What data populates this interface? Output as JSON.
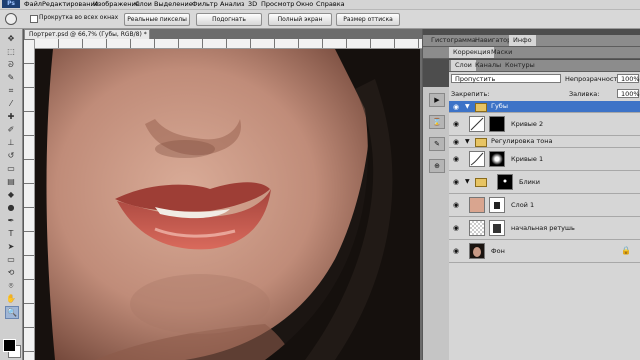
{
  "app": {
    "logo": "Ps"
  },
  "menu": [
    "Файл",
    "Редактирование",
    "Изображение",
    "Слои",
    "Выделение",
    "Фильтр",
    "Анализ",
    "3D",
    "Просмотр",
    "Окно",
    "Справка"
  ],
  "options_bar": {
    "scroll_all_label": "Прокрутка во всех окнах",
    "buttons": [
      "Реальные пикселы",
      "Подогнать",
      "Полный экран",
      "Размер оттиска"
    ]
  },
  "document": {
    "tab_title": "Портрет.psd @ 66,7% (Губы, RGB/8) *"
  },
  "panels": {
    "top_tabs": [
      "Гистограмма",
      "Навигатор",
      "Инфо"
    ],
    "adjust_tabs": [
      "Коррекция",
      "Маски"
    ],
    "layer_tabs": [
      "Слои",
      "Каналы",
      "Контуры"
    ]
  },
  "layers_panel": {
    "blend_mode": "Пропустить",
    "opacity_label": "Непрозрачность:",
    "opacity_value": "100%",
    "lock_label": "Закрепить:",
    "fill_label": "Заливка:",
    "fill_value": "100%",
    "layers": [
      {
        "name": "Губы",
        "kind": "group",
        "selected": true
      },
      {
        "name": "Кривые 2",
        "kind": "adjustment"
      },
      {
        "name": "Регулировка тона",
        "kind": "group"
      },
      {
        "name": "Кривые 1",
        "kind": "adjustment"
      },
      {
        "name": "Блики",
        "kind": "group"
      },
      {
        "name": "Слой 1",
        "kind": "pixel"
      },
      {
        "name": "начальная ретушь",
        "kind": "pixel"
      },
      {
        "name": "Фон",
        "kind": "background"
      }
    ]
  },
  "colors": {
    "selection_blue": "#3d73c7",
    "lip": "#c9574f",
    "skin": "#c99a86"
  }
}
